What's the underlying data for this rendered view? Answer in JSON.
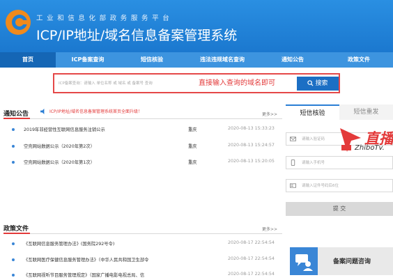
{
  "header": {
    "subtitle": "工业和信息化部政务服务平台",
    "title": "ICP/IP地址/域名信息备案管理系统"
  },
  "nav": {
    "items": [
      {
        "label": "首页",
        "active": true
      },
      {
        "label": "ICP备案查询"
      },
      {
        "label": "短信核验"
      },
      {
        "label": "违法违规域名查询"
      },
      {
        "label": "通知公告"
      },
      {
        "label": "政策文件"
      }
    ]
  },
  "search": {
    "placeholder": "ICP备案查询：请输入 单位名称 或 域名 或 备案号 查询",
    "hint": "直接输入查询的域名即可",
    "button": "搜索"
  },
  "notices": {
    "title": "通知公告",
    "marquee": "ICP/IP地址/域名信息备案管理系统首页全面升级！",
    "more": "更多>>",
    "rows": [
      {
        "title": "2019年非经营性互联网信息服务注销公示",
        "region": "重庆",
        "time": "2020-08-13 15:33:23"
      },
      {
        "title": "空壳网站数据公示（2020年第2次）",
        "region": "重庆",
        "time": "2020-08-13 15:24:57"
      },
      {
        "title": "空壳网站数据公示（2020年第1次）",
        "region": "重庆",
        "time": "2020-08-13 15:20:05"
      }
    ]
  },
  "policies": {
    "title": "政策文件",
    "more": "更多>>",
    "rows": [
      {
        "title": "《互联网信息服务管理办法》(国务院292号令)",
        "region": "",
        "time": "2020-08-17 22:54:54"
      },
      {
        "title": "《互联网医疗保健信息服务管理办法》（中华人民共和国卫生部令",
        "region": "",
        "time": "2020-08-17 22:54:54"
      },
      {
        "title": "《互联网视听节目服务管理规定》（国家广播电影电视总局、信",
        "region": "",
        "time": "2020-08-17 22:54:54"
      }
    ]
  },
  "sms": {
    "tabs": [
      {
        "label": "短信核验",
        "active": true
      },
      {
        "label": "短信重发"
      }
    ],
    "fields": [
      "请输入验证码",
      "请输入手机号",
      "请输入证件号码后6位"
    ],
    "submit": "提 交"
  },
  "help": {
    "label": "备案问题咨询",
    "icon": "chat-user-icon"
  },
  "watermark": {
    "text": "直播",
    "url": "ZhiboTv."
  },
  "colors": {
    "header": "#1d7fd6",
    "nav": "#3d94df",
    "nav_active": "#1566b5",
    "accent_red": "#e33a3a",
    "button_blue": "#1c6fc4"
  }
}
